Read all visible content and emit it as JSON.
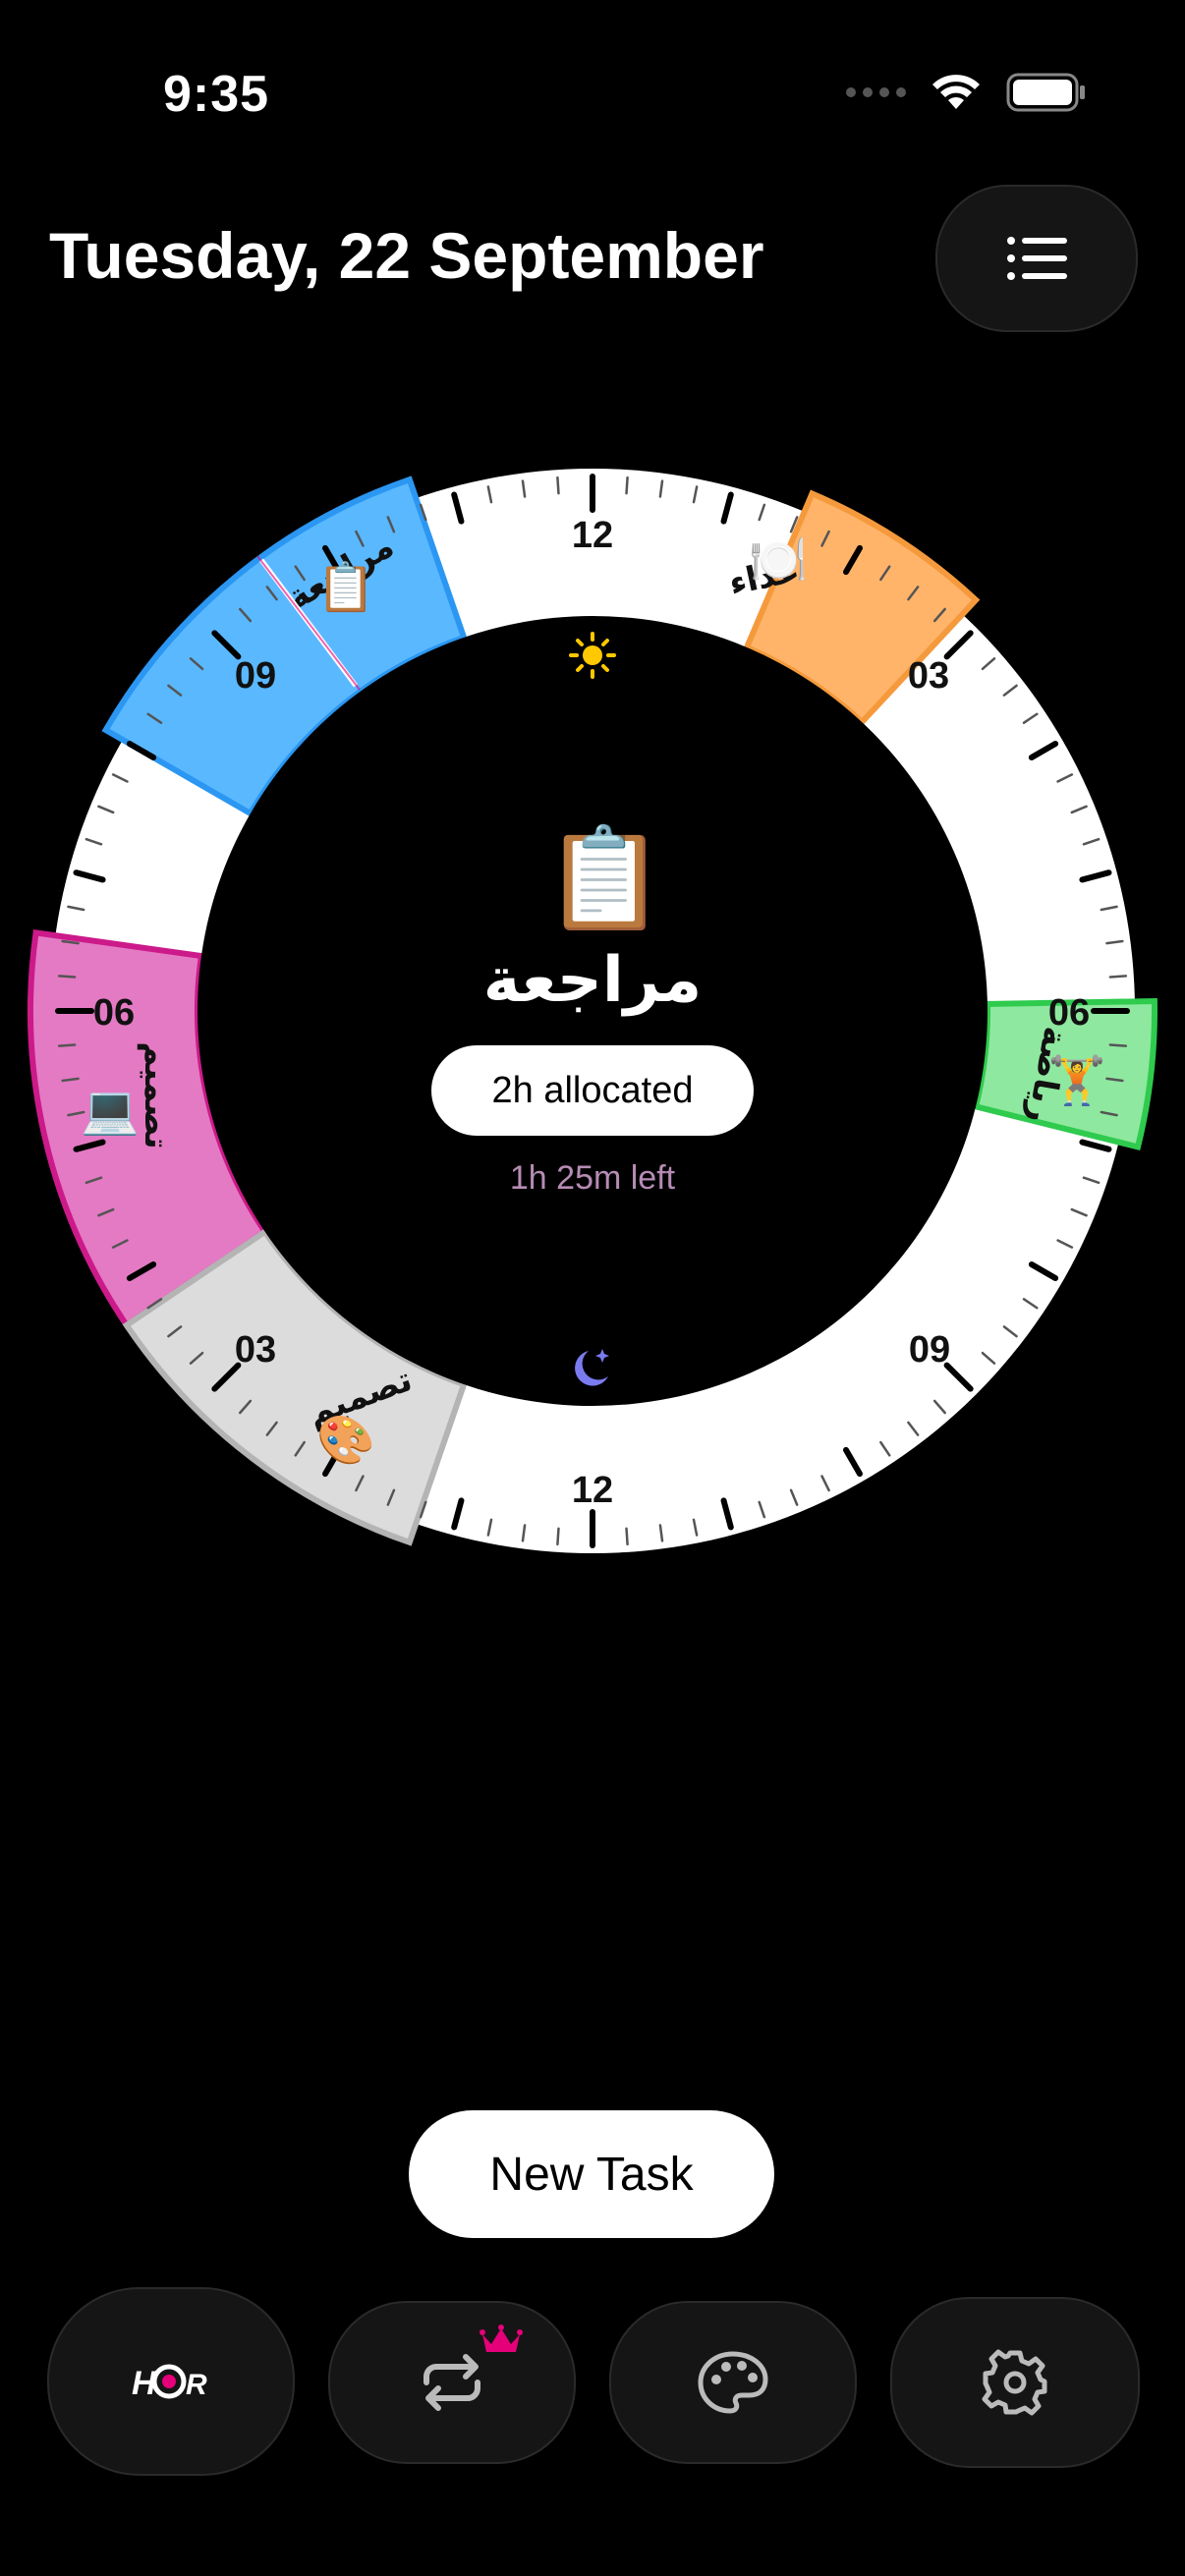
{
  "status_bar": {
    "time": "9:35"
  },
  "header": {
    "date": "Tuesday, 22 September"
  },
  "dial": {
    "top_labels": [
      "12",
      "03",
      "06",
      "09"
    ],
    "bottom_labels": [
      "12",
      "09",
      "06",
      "03"
    ],
    "tasks": [
      {
        "label": "مراجعة",
        "emoji": "📋",
        "color": "#5ab8ff"
      },
      {
        "label": "غداء",
        "emoji": "🍽️",
        "color": "#ffb46a"
      },
      {
        "label": "رياضة",
        "emoji": "🏋️",
        "color": "#8fe89f"
      },
      {
        "label": "تصميم",
        "emoji": "💻",
        "color": "#e47ac3"
      },
      {
        "label": "تصميم",
        "emoji": "🎨",
        "color": "#dcdcdc"
      }
    ],
    "sun_icon": "sun-icon",
    "moon_icon": "moon-stars-icon"
  },
  "current_task": {
    "emoji": "📋",
    "name": "مراجعة",
    "allocated": "2h allocated",
    "remaining": "1h 25m left"
  },
  "actions": {
    "new_task": "New Task"
  },
  "tabbar": {
    "items": [
      {
        "icon": "hour-logo-icon",
        "text": "HOUR"
      },
      {
        "icon": "repeat-icon",
        "badge": "crown-icon"
      },
      {
        "icon": "palette-icon"
      },
      {
        "icon": "gear-icon"
      }
    ]
  },
  "colors": {
    "accent_pink": "#e5007a",
    "background": "#000000"
  }
}
